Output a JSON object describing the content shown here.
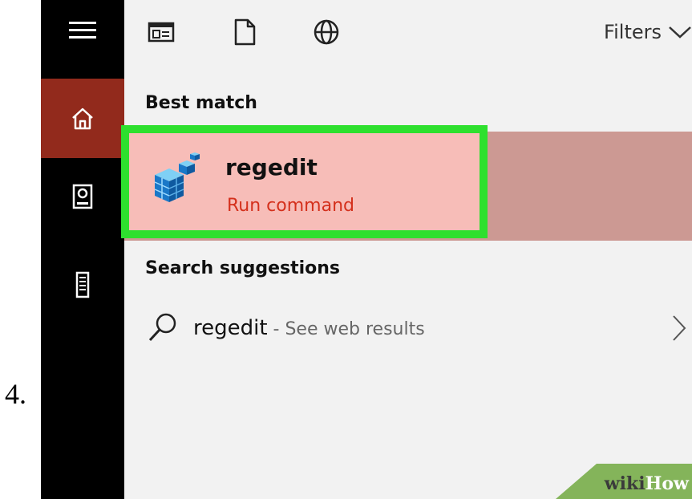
{
  "step_number": "4.",
  "sidebar": {
    "items": [
      {
        "icon": "hamburger-menu-icon"
      },
      {
        "icon": "home-icon",
        "active": true
      },
      {
        "icon": "documents-icon"
      },
      {
        "icon": "server-tower-icon"
      }
    ]
  },
  "toolbar": {
    "icons": [
      "apps-icon",
      "document-icon",
      "web-globe-icon"
    ],
    "filters_label": "Filters"
  },
  "best_match": {
    "heading": "Best match",
    "app_name": "regedit",
    "app_subtitle": "Run command",
    "app_icon": "registry-editor-icon"
  },
  "search_suggestions": {
    "heading": "Search suggestions",
    "query": "regedit",
    "suffix": " - See web results"
  },
  "watermark": {
    "part1": "wiki",
    "part2": "How"
  },
  "colors": {
    "sidebar_bg": "#000000",
    "sidebar_active": "#922a1c",
    "highlight_bg": "#f7bdb8",
    "row_bg": "#cc9993",
    "green_outline": "#2ee02e",
    "subtitle_red": "#d4301c"
  }
}
